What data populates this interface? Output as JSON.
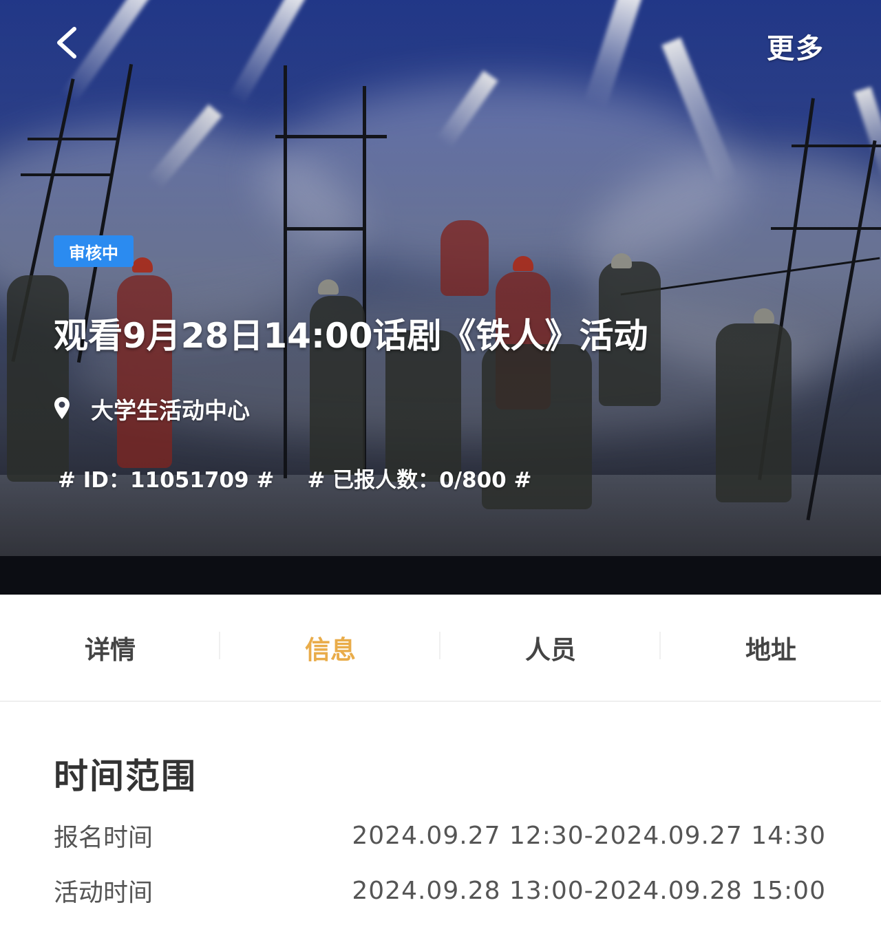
{
  "header": {
    "more_label": "更多"
  },
  "event": {
    "status": "审核中",
    "title": "观看9月28日14:00话剧《铁人》活动",
    "location": "大学生活动中心",
    "id_text": "# ID：11051709 #",
    "signup_text": "# 已报人数：0/800 #"
  },
  "tabs": [
    {
      "label": "详情",
      "active": false
    },
    {
      "label": "信息",
      "active": true
    },
    {
      "label": "人员",
      "active": false
    },
    {
      "label": "地址",
      "active": false
    }
  ],
  "time_range": {
    "title": "时间范围",
    "rows": [
      {
        "label": "报名时间",
        "value": "2024.09.27 12:30-2024.09.27 14:30"
      },
      {
        "label": "活动时间",
        "value": "2024.09.28 13:00-2024.09.28 15:00"
      }
    ]
  },
  "colors": {
    "accent": "#e9ac4a",
    "badge": "#2b8bf0"
  },
  "icons": {
    "back": "chevron-left-icon",
    "location": "location-pin-icon"
  }
}
